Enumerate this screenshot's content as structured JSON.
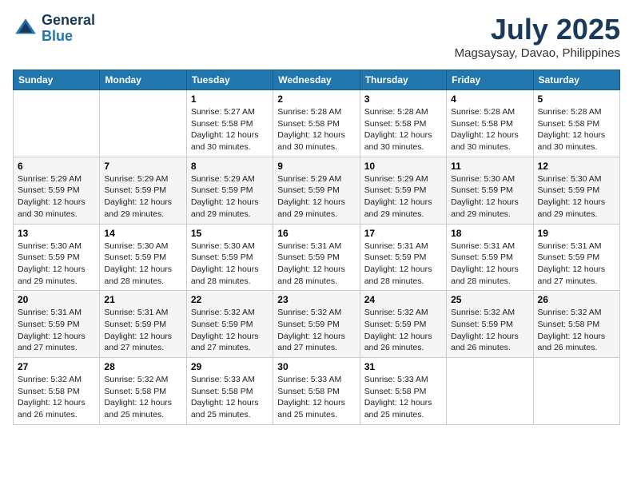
{
  "header": {
    "logo_line1": "General",
    "logo_line2": "Blue",
    "month_title": "July 2025",
    "subtitle": "Magsaysay, Davao, Philippines"
  },
  "weekdays": [
    "Sunday",
    "Monday",
    "Tuesday",
    "Wednesday",
    "Thursday",
    "Friday",
    "Saturday"
  ],
  "weeks": [
    [
      {
        "day": "",
        "info": ""
      },
      {
        "day": "",
        "info": ""
      },
      {
        "day": "1",
        "info": "Sunrise: 5:27 AM\nSunset: 5:58 PM\nDaylight: 12 hours and 30 minutes."
      },
      {
        "day": "2",
        "info": "Sunrise: 5:28 AM\nSunset: 5:58 PM\nDaylight: 12 hours and 30 minutes."
      },
      {
        "day": "3",
        "info": "Sunrise: 5:28 AM\nSunset: 5:58 PM\nDaylight: 12 hours and 30 minutes."
      },
      {
        "day": "4",
        "info": "Sunrise: 5:28 AM\nSunset: 5:58 PM\nDaylight: 12 hours and 30 minutes."
      },
      {
        "day": "5",
        "info": "Sunrise: 5:28 AM\nSunset: 5:58 PM\nDaylight: 12 hours and 30 minutes."
      }
    ],
    [
      {
        "day": "6",
        "info": "Sunrise: 5:29 AM\nSunset: 5:59 PM\nDaylight: 12 hours and 30 minutes."
      },
      {
        "day": "7",
        "info": "Sunrise: 5:29 AM\nSunset: 5:59 PM\nDaylight: 12 hours and 29 minutes."
      },
      {
        "day": "8",
        "info": "Sunrise: 5:29 AM\nSunset: 5:59 PM\nDaylight: 12 hours and 29 minutes."
      },
      {
        "day": "9",
        "info": "Sunrise: 5:29 AM\nSunset: 5:59 PM\nDaylight: 12 hours and 29 minutes."
      },
      {
        "day": "10",
        "info": "Sunrise: 5:29 AM\nSunset: 5:59 PM\nDaylight: 12 hours and 29 minutes."
      },
      {
        "day": "11",
        "info": "Sunrise: 5:30 AM\nSunset: 5:59 PM\nDaylight: 12 hours and 29 minutes."
      },
      {
        "day": "12",
        "info": "Sunrise: 5:30 AM\nSunset: 5:59 PM\nDaylight: 12 hours and 29 minutes."
      }
    ],
    [
      {
        "day": "13",
        "info": "Sunrise: 5:30 AM\nSunset: 5:59 PM\nDaylight: 12 hours and 29 minutes."
      },
      {
        "day": "14",
        "info": "Sunrise: 5:30 AM\nSunset: 5:59 PM\nDaylight: 12 hours and 28 minutes."
      },
      {
        "day": "15",
        "info": "Sunrise: 5:30 AM\nSunset: 5:59 PM\nDaylight: 12 hours and 28 minutes."
      },
      {
        "day": "16",
        "info": "Sunrise: 5:31 AM\nSunset: 5:59 PM\nDaylight: 12 hours and 28 minutes."
      },
      {
        "day": "17",
        "info": "Sunrise: 5:31 AM\nSunset: 5:59 PM\nDaylight: 12 hours and 28 minutes."
      },
      {
        "day": "18",
        "info": "Sunrise: 5:31 AM\nSunset: 5:59 PM\nDaylight: 12 hours and 28 minutes."
      },
      {
        "day": "19",
        "info": "Sunrise: 5:31 AM\nSunset: 5:59 PM\nDaylight: 12 hours and 27 minutes."
      }
    ],
    [
      {
        "day": "20",
        "info": "Sunrise: 5:31 AM\nSunset: 5:59 PM\nDaylight: 12 hours and 27 minutes."
      },
      {
        "day": "21",
        "info": "Sunrise: 5:31 AM\nSunset: 5:59 PM\nDaylight: 12 hours and 27 minutes."
      },
      {
        "day": "22",
        "info": "Sunrise: 5:32 AM\nSunset: 5:59 PM\nDaylight: 12 hours and 27 minutes."
      },
      {
        "day": "23",
        "info": "Sunrise: 5:32 AM\nSunset: 5:59 PM\nDaylight: 12 hours and 27 minutes."
      },
      {
        "day": "24",
        "info": "Sunrise: 5:32 AM\nSunset: 5:59 PM\nDaylight: 12 hours and 26 minutes."
      },
      {
        "day": "25",
        "info": "Sunrise: 5:32 AM\nSunset: 5:59 PM\nDaylight: 12 hours and 26 minutes."
      },
      {
        "day": "26",
        "info": "Sunrise: 5:32 AM\nSunset: 5:58 PM\nDaylight: 12 hours and 26 minutes."
      }
    ],
    [
      {
        "day": "27",
        "info": "Sunrise: 5:32 AM\nSunset: 5:58 PM\nDaylight: 12 hours and 26 minutes."
      },
      {
        "day": "28",
        "info": "Sunrise: 5:32 AM\nSunset: 5:58 PM\nDaylight: 12 hours and 25 minutes."
      },
      {
        "day": "29",
        "info": "Sunrise: 5:33 AM\nSunset: 5:58 PM\nDaylight: 12 hours and 25 minutes."
      },
      {
        "day": "30",
        "info": "Sunrise: 5:33 AM\nSunset: 5:58 PM\nDaylight: 12 hours and 25 minutes."
      },
      {
        "day": "31",
        "info": "Sunrise: 5:33 AM\nSunset: 5:58 PM\nDaylight: 12 hours and 25 minutes."
      },
      {
        "day": "",
        "info": ""
      },
      {
        "day": "",
        "info": ""
      }
    ]
  ]
}
